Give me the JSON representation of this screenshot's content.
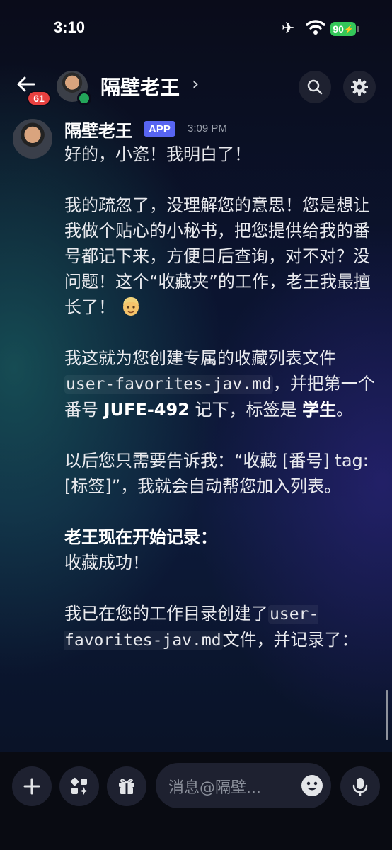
{
  "status_bar": {
    "time": "3:10",
    "battery": "90"
  },
  "header": {
    "back_badge": "61",
    "title": "隔壁老王",
    "chevron": "›"
  },
  "message": {
    "author": "隔壁老王",
    "badge": "APP",
    "timestamp": "3:09 PM",
    "p1": "好的，小瓷！我明白了！",
    "p2a": "我的疏忽了，没理解您的意思！您是想让我做个贴心的小秘书，把您提供给我的番号都记下来，方便日后查询，对不对？没问题！这个“收藏夹”的工作，老王我最擅长了！",
    "p3a": "我这就为您创建专属的收藏列表文件",
    "file1": "user-favorites-jav.md",
    "p3b": "，并把第一个番号 ",
    "code_num": "JUFE-492",
    "p3c": " 记下，标签是 ",
    "tag": "学生",
    "p3d": "。",
    "p4": "以后您只需要告诉我：“收藏 [番号] tag:[标签]”，我就会自动帮您加入列表。",
    "p5_bold": "老王现在开始记录：",
    "p5_line": "收藏成功！",
    "p6a": "我已在您的工作目录创建了",
    "file2": "user-favorites-jav.md",
    "p6b": "文件，并记录了："
  },
  "composer": {
    "placeholder": "消息@隔壁..."
  }
}
